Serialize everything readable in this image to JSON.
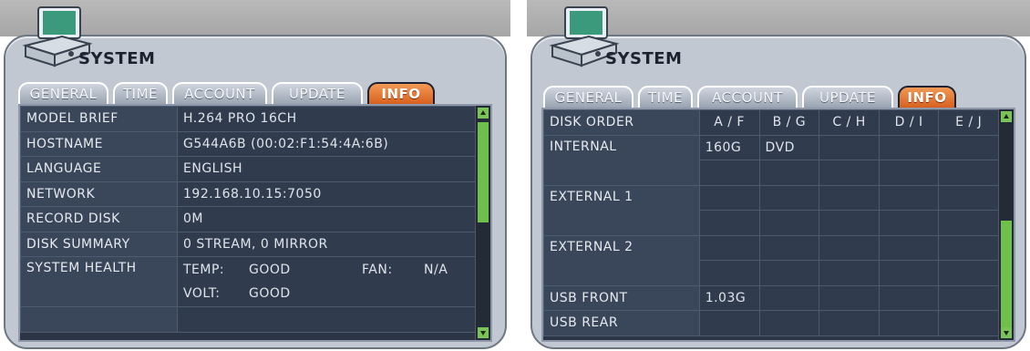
{
  "left": {
    "title": "SYSTEM",
    "tabs": [
      "GENERAL",
      "TIME",
      "ACCOUNT",
      "UPDATE",
      "INFO"
    ],
    "active_tab": "INFO",
    "rows": [
      {
        "key": "MODEL BRIEF",
        "value": "H.264 PRO 16CH"
      },
      {
        "key": "HOSTNAME",
        "value": "G544A6B (00:02:F1:54:4A:6B)"
      },
      {
        "key": "LANGUAGE",
        "value": "ENGLISH"
      },
      {
        "key": "NETWORK",
        "value": "192.168.10.15:7050"
      },
      {
        "key": "RECORD DISK",
        "value": "0M"
      },
      {
        "key": "DISK SUMMARY",
        "value": "0 STREAM, 0 MIRROR"
      },
      {
        "key": "SYSTEM HEALTH",
        "value": ""
      },
      {
        "key": "",
        "value": ""
      }
    ],
    "health": {
      "temp_label": "TEMP:",
      "temp_value": "GOOD",
      "fan_label": "FAN:",
      "fan_value": "N/A",
      "volt_label": "VOLT:",
      "volt_value": "GOOD"
    },
    "scroll_position": 0.25
  },
  "right": {
    "title": "SYSTEM",
    "tabs": [
      "GENERAL",
      "TIME",
      "ACCOUNT",
      "UPDATE",
      "INFO"
    ],
    "active_tab": "INFO",
    "columns": [
      "DISK ORDER",
      "A / F",
      "B / G",
      "C / H",
      "D / I",
      "E / J"
    ],
    "rows": [
      {
        "label": "INTERNAL",
        "cells": [
          "160G",
          "DVD",
          "",
          "",
          ""
        ]
      },
      {
        "label": "",
        "cells": [
          "",
          "",
          "",
          "",
          ""
        ]
      },
      {
        "label": "EXTERNAL 1",
        "cells": [
          "",
          "",
          "",
          "",
          ""
        ]
      },
      {
        "label": "",
        "cells": [
          "",
          "",
          "",
          "",
          ""
        ]
      },
      {
        "label": "EXTERNAL 2",
        "cells": [
          "",
          "",
          "",
          "",
          ""
        ]
      },
      {
        "label": "",
        "cells": [
          "",
          "",
          "",
          "",
          ""
        ]
      },
      {
        "label": "USB FRONT",
        "cells": [
          "1.03G",
          "",
          "",
          "",
          ""
        ]
      },
      {
        "label": "USB REAR",
        "cells": [
          "",
          "",
          "",
          "",
          ""
        ]
      }
    ],
    "scroll_position": 1.0
  }
}
